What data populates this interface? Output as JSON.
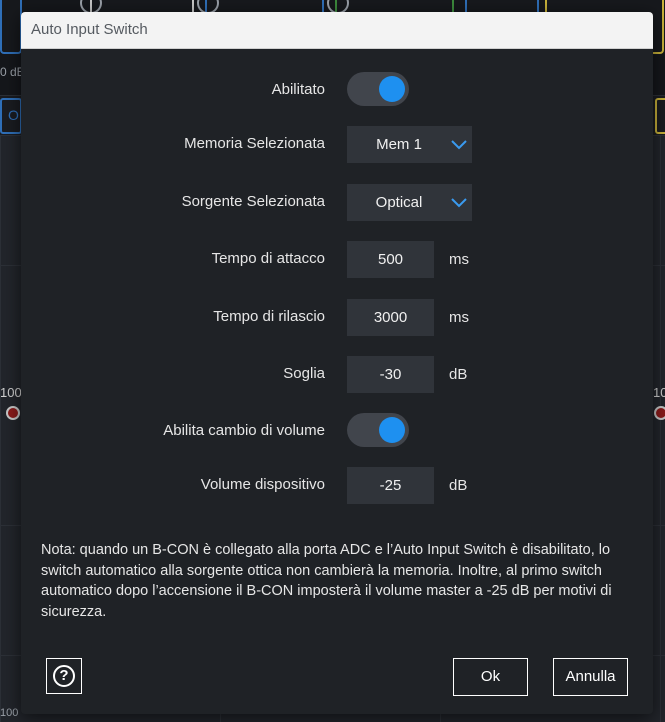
{
  "background": {
    "left_label": "0 dB",
    "tab_letter": "O",
    "scale_left": "100",
    "scale_right": "10",
    "scale_bottom": "100"
  },
  "dialog": {
    "title": "Auto Input Switch",
    "fields": {
      "enabled": {
        "label": "Abilitato",
        "state": "on"
      },
      "memory": {
        "label": "Memoria Selezionata",
        "value": "Mem 1",
        "icon": "chevron-down-icon"
      },
      "source": {
        "label": "Sorgente Selezionata",
        "value": "Optical",
        "icon": "chevron-down-icon"
      },
      "attack": {
        "label": "Tempo di attacco",
        "value": "500",
        "unit": "ms"
      },
      "release": {
        "label": "Tempo di rilascio",
        "value": "3000",
        "unit": "ms"
      },
      "threshold": {
        "label": "Soglia",
        "value": "-30",
        "unit": "dB"
      },
      "volume_change": {
        "label": "Abilita cambio di volume",
        "state": "on"
      },
      "device_volume": {
        "label": "Volume dispositivo",
        "value": "-25",
        "unit": "dB"
      }
    },
    "note": "Nota: quando un B-CON è collegato alla porta ADC e l’Auto Input Switch è disabilitato, lo switch automatico alla sorgente ottica non cambierà la memoria. Inoltre, al primo switch automatico dopo l’accensione il B-CON imposterà il volume master a -25 dB per motivi di sicurezza.",
    "help_glyph": "?",
    "buttons": {
      "ok": "Ok",
      "cancel": "Annulla"
    }
  },
  "colors": {
    "accent": "#1e90f0",
    "dialog_bg": "#1f2226",
    "input_bg": "#30343a",
    "toggle_track": "#41454c",
    "titlebar_bg": "#f3f3f3"
  }
}
